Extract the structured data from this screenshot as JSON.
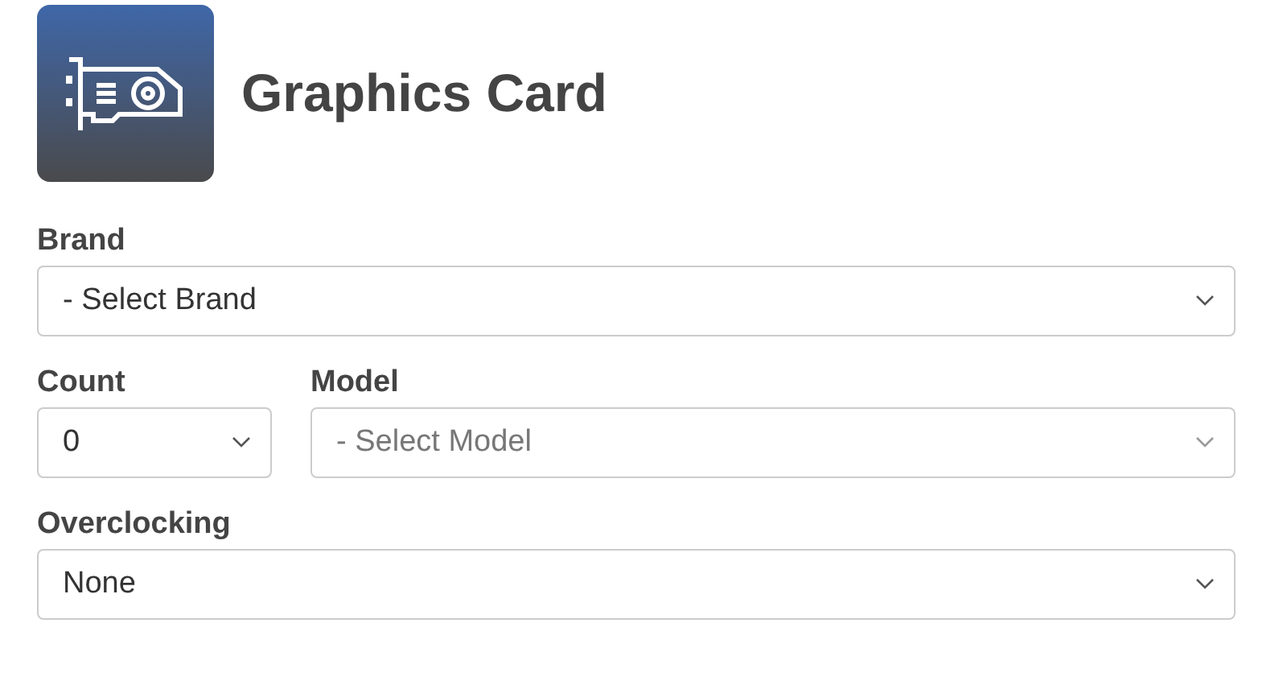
{
  "header": {
    "title": "Graphics Card"
  },
  "rows": [
    {
      "fields": [
        {
          "label": "Brand",
          "value": "- Select Brand",
          "kind": "full"
        }
      ]
    },
    {
      "fields": [
        {
          "label": "Count",
          "value": "0",
          "kind": "short"
        },
        {
          "label": "Model",
          "placeholder": "- Select Model",
          "kind": "full"
        }
      ]
    },
    {
      "fields": [
        {
          "label": "Overclocking",
          "value": "None",
          "kind": "full"
        }
      ]
    }
  ]
}
